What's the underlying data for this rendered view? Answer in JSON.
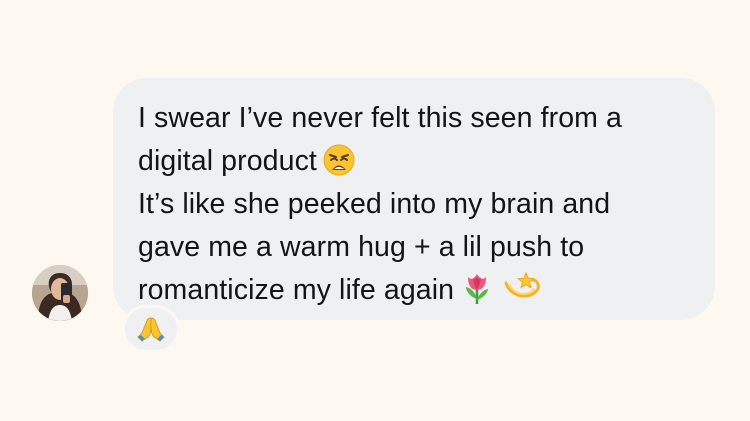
{
  "message": {
    "line1": "I swear I’ve never felt this seen from a",
    "line2": "digital product",
    "line3": "It’s like she peeked into my brain and",
    "line4": "gave me a warm hug + a lil push to",
    "line5": "romanticize my life again",
    "line2_emoji": "weary-face-emoji",
    "line5_emojis": [
      "tulip-emoji",
      "dizzy-emoji"
    ]
  },
  "reaction": {
    "icon": "folded-hands-emoji"
  },
  "colors": {
    "background": "#fdf9f1",
    "bubble": "#eff0f2",
    "text": "#141414"
  }
}
